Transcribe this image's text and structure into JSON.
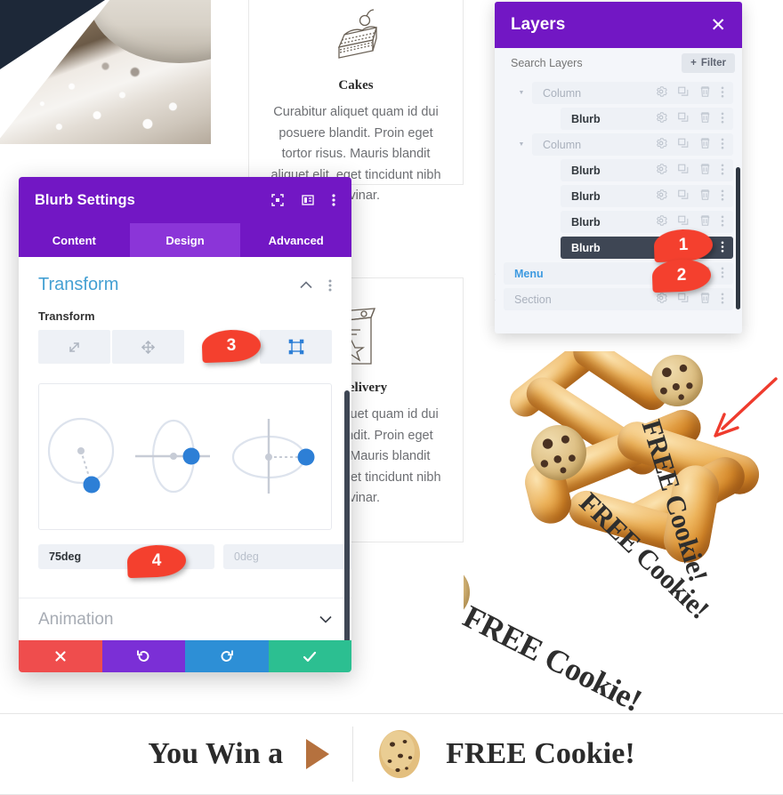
{
  "background": {
    "cards": [
      {
        "title": "Cakes",
        "body": "Curabitur aliquet quam id dui posuere blandit. Proin eget tortor risus. Mauris blandit aliquet elit, eget tincidunt nibh pulvinar.",
        "icon": "cake-slice-icon"
      },
      {
        "title": "& Delivery",
        "body": "Curabitur aliquet quam id dui posuere blandit. Proin eget tortor risus. Mauris blandit aliquet elit, eget tincidunt nibh pulvinar.",
        "icon": "shopping-bag-icon"
      }
    ],
    "promo_labels": [
      "FREE Cookie!",
      "FREE Cookie!",
      "FREE Cookie!"
    ],
    "banner": {
      "left_text": "You Win a",
      "right_text": "FREE Cookie!",
      "arrow_icon": "play-triangle-icon",
      "cookie_icon": "chocolate-chip-cookie-icon"
    }
  },
  "layers_panel": {
    "title": "Layers",
    "close_icon": "close-icon",
    "search_placeholder": "Search Layers",
    "filter_label": "Filter",
    "filter_icon": "plus-icon",
    "row_icons": [
      "gear-icon",
      "duplicate-icon",
      "trash-icon",
      "more-vertical-icon"
    ],
    "rows": [
      {
        "label": "Column",
        "depth": 1,
        "caret": "down",
        "muted": true,
        "selected": false
      },
      {
        "label": "Blurb",
        "depth": 2,
        "caret": "",
        "muted": false,
        "selected": false
      },
      {
        "label": "Column",
        "depth": 1,
        "caret": "down",
        "muted": true,
        "selected": false
      },
      {
        "label": "Blurb",
        "depth": 2,
        "caret": "",
        "muted": false,
        "selected": false
      },
      {
        "label": "Blurb",
        "depth": 2,
        "caret": "",
        "muted": false,
        "selected": false
      },
      {
        "label": "Blurb",
        "depth": 2,
        "caret": "",
        "muted": false,
        "selected": false
      },
      {
        "label": "Blurb",
        "depth": 2,
        "caret": "",
        "muted": false,
        "selected": true
      },
      {
        "label": "Menu",
        "depth": 0,
        "caret": "right",
        "muted": false,
        "selected": false,
        "link": true
      },
      {
        "label": "Section",
        "depth": 0,
        "caret": "right",
        "muted": true,
        "selected": false
      }
    ]
  },
  "modal": {
    "title": "Blurb Settings",
    "head_icons": [
      "focus-target-icon",
      "layout-panel-icon",
      "more-vertical-icon"
    ],
    "tabs": [
      {
        "label": "Content",
        "active": false
      },
      {
        "label": "Design",
        "active": true
      },
      {
        "label": "Advanced",
        "active": false
      }
    ],
    "section_title": "Transform",
    "section_collapse_icon": "chevron-up-icon",
    "section_more_icon": "more-vertical-icon",
    "field_label": "Transform",
    "transform_buttons": [
      {
        "icon": "scale-icon",
        "name": "transform-scale",
        "active": false
      },
      {
        "icon": "translate-icon",
        "name": "transform-translate",
        "active": false
      },
      {
        "icon": "rotate-icon",
        "name": "transform-rotate",
        "active": true
      },
      {
        "icon": "skew-icon",
        "name": "transform-skew",
        "active": false
      }
    ],
    "rotate_controls": [
      {
        "axis": "z",
        "name": "rotate-z-control"
      },
      {
        "axis": "y",
        "name": "rotate-y-control"
      },
      {
        "axis": "x",
        "name": "rotate-x-control"
      }
    ],
    "degree_inputs": [
      {
        "value": "75deg",
        "filled": true,
        "name": "rotate-z-input"
      },
      {
        "value": "0deg",
        "filled": false,
        "name": "rotate-y-input"
      },
      {
        "value": "0deg",
        "filled": false,
        "name": "rotate-x-input"
      }
    ],
    "next_section_title": "Animation",
    "next_section_icon": "chevron-down-icon",
    "footer_buttons": [
      {
        "icon": "close-icon",
        "name": "cancel-button",
        "color": "#ef4d4d"
      },
      {
        "icon": "undo-icon",
        "name": "undo-button",
        "color": "#7b2fd6"
      },
      {
        "icon": "redo-icon",
        "name": "redo-button",
        "color": "#2d8fd6"
      },
      {
        "icon": "check-icon",
        "name": "save-button",
        "color": "#2cbf91"
      }
    ]
  },
  "callouts": [
    {
      "number": "1",
      "name": "callout-1"
    },
    {
      "number": "2",
      "name": "callout-2"
    },
    {
      "number": "3",
      "name": "callout-3"
    },
    {
      "number": "4",
      "name": "callout-4"
    }
  ],
  "colors": {
    "brand_purple": "#7217c4",
    "tab_active": "#8b35d8",
    "accent_blue": "#2d8fd6",
    "callout_red": "#f4402e",
    "selected_row": "#3e4654"
  }
}
